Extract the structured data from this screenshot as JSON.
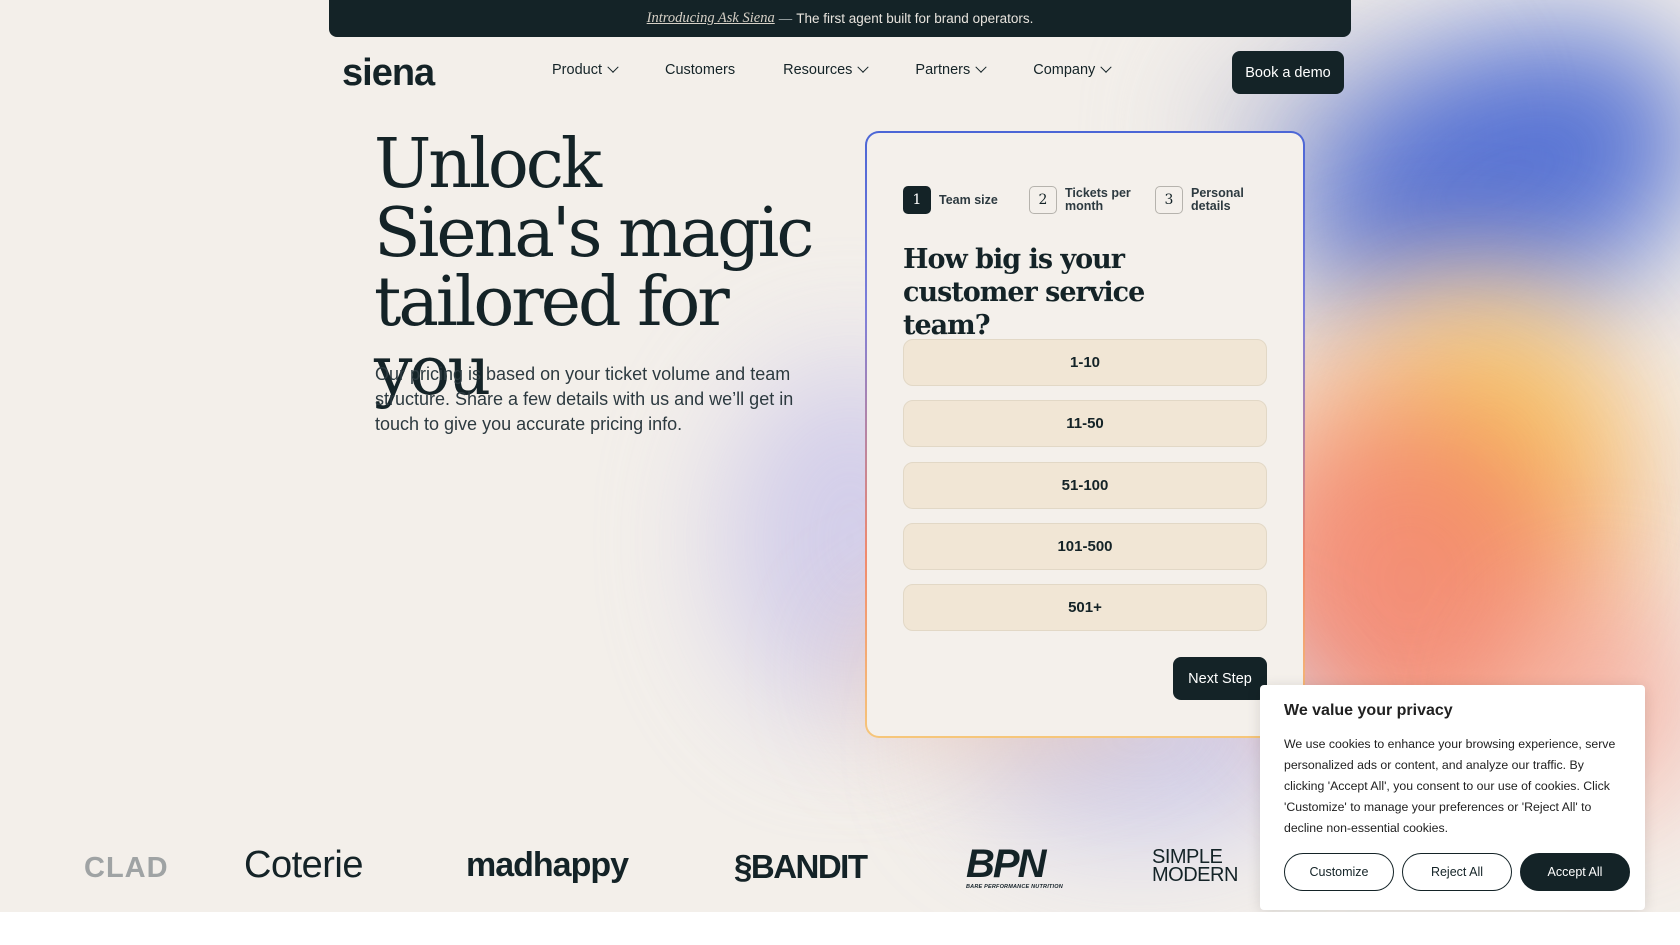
{
  "announcement": {
    "link_text": "Introducing Ask Siena",
    "separator": "—",
    "text": "The first agent built for brand operators."
  },
  "header": {
    "logo": "siena",
    "nav": [
      {
        "label": "Product",
        "has_dropdown": true
      },
      {
        "label": "Customers",
        "has_dropdown": false
      },
      {
        "label": "Resources",
        "has_dropdown": true
      },
      {
        "label": "Partners",
        "has_dropdown": true
      },
      {
        "label": "Company",
        "has_dropdown": true
      }
    ],
    "cta": "Book a demo"
  },
  "hero": {
    "title": "Unlock Siena's magic tailored for you",
    "subtitle": "Our pricing is based on your ticket volume and team structure. Share a few details with us and we’ll get in touch to give you accurate pricing info."
  },
  "form": {
    "steps": [
      {
        "num": "1",
        "label": "Team size",
        "active": true
      },
      {
        "num": "2",
        "label": "Tickets per month",
        "active": false
      },
      {
        "num": "3",
        "label": "Personal details",
        "active": false
      }
    ],
    "question": "How big is your customer service team?",
    "options": [
      "1-10",
      "11-50",
      "51-100",
      "101-500",
      "501+"
    ],
    "next_label": "Next Step"
  },
  "logos": {
    "clad": "CLAD",
    "coterie": "Coterie",
    "madhappy": "madhappy",
    "bandit": "BANDIT",
    "bpn": "BPN",
    "bpn_sub": "BARE PERFORMANCE NUTRITION",
    "simple_line1": "SIMPLE",
    "simple_line2": "MODERN"
  },
  "cookie": {
    "title": "We value your privacy",
    "text": "We use cookies to enhance your browsing experience, serve personalized ads or content, and analyze our traffic. By clicking 'Accept All', you consent to our use of cookies. Click 'Customize' to manage your preferences or 'Reject All' to decline non-essential cookies.",
    "customize": "Customize",
    "reject": "Reject All",
    "accept": "Accept All"
  },
  "colors": {
    "background": "#f3efea",
    "dark": "#142327",
    "option_bg": "#f1e6d5",
    "accent_blue": "#3e5fd0",
    "accent_coral": "#f37b6a",
    "accent_yellow": "#f7c94a"
  }
}
